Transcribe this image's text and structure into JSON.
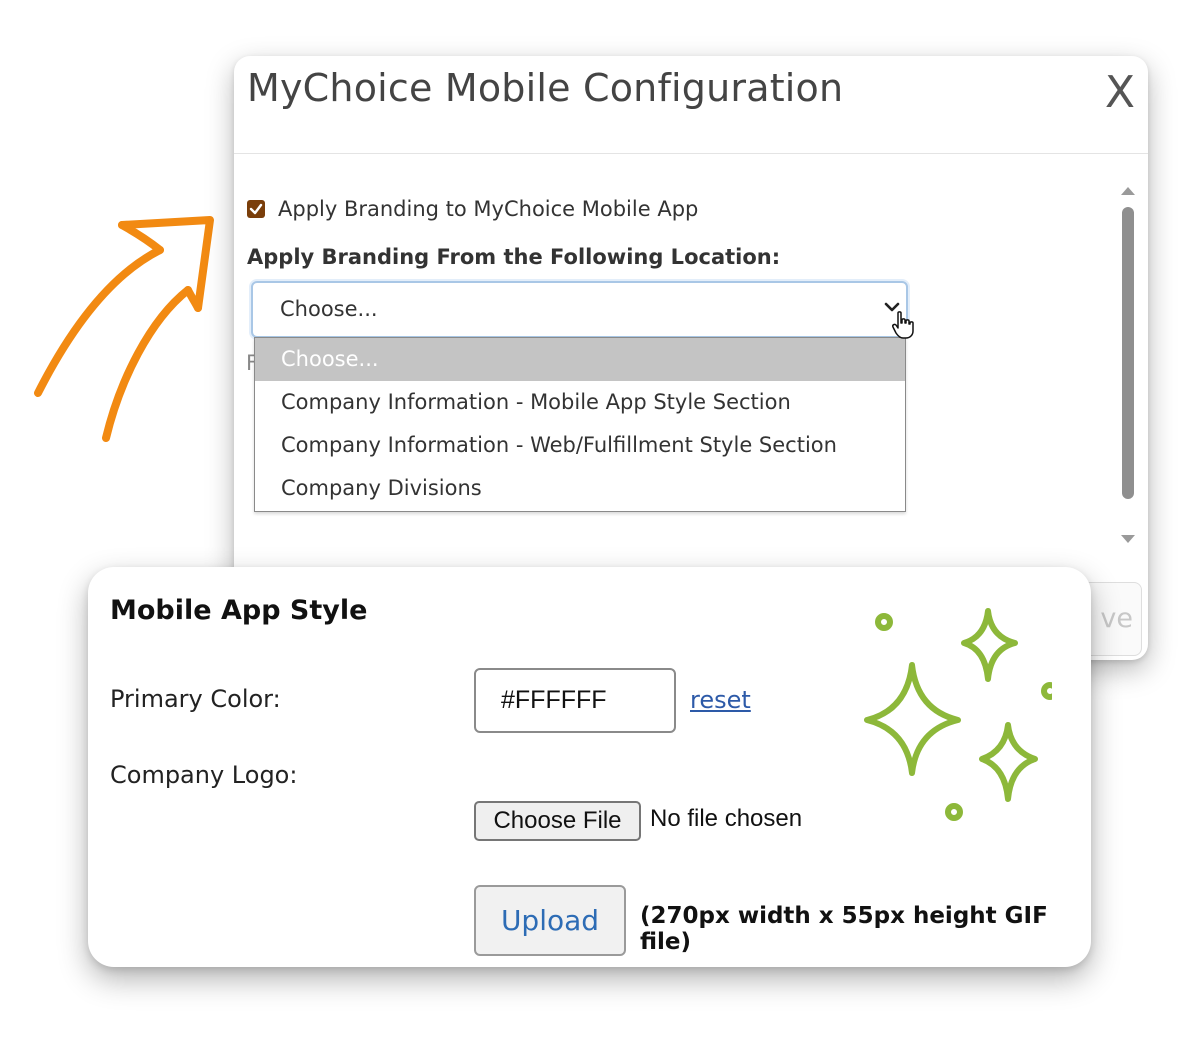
{
  "modal": {
    "title": "MyChoice Mobile Configuration",
    "close_label": "X",
    "apply_branding_checkbox": {
      "label": "Apply Branding to MyChoice Mobile App",
      "checked": true
    },
    "location_label": "Apply Branding From the Following Location:",
    "location_select": {
      "value": "Choose...",
      "options": [
        "Choose...",
        "Company Information - Mobile App Style Section",
        "Company Information - Web/Fulfillment Style Section",
        "Company Divisions"
      ],
      "highlighted_option": "Choose..."
    },
    "obscured_text": "F",
    "save_button_partial": "ve"
  },
  "mobile_app_style": {
    "title": "Mobile App Style",
    "primary_color_label": "Primary Color:",
    "primary_color_value": "#FFFFFF",
    "reset_link": "reset",
    "company_logo_label": "Company Logo:",
    "choose_file_button": "Choose File",
    "file_status": "No file chosen",
    "upload_button": "Upload",
    "upload_note": "(270px width x 55px height GIF file)"
  },
  "colors": {
    "checkbox": "#7a3e0a",
    "arrow": "#f28a12",
    "sparkles": "#8db83a",
    "link": "#2d5aa8",
    "upload_text": "#2d6cb5"
  },
  "icons": [
    "arrow-doodle-icon",
    "check-icon",
    "chevron-down-icon",
    "hand-cursor-icon",
    "sparkles-icon",
    "scroll-up-icon",
    "scroll-down-icon"
  ]
}
